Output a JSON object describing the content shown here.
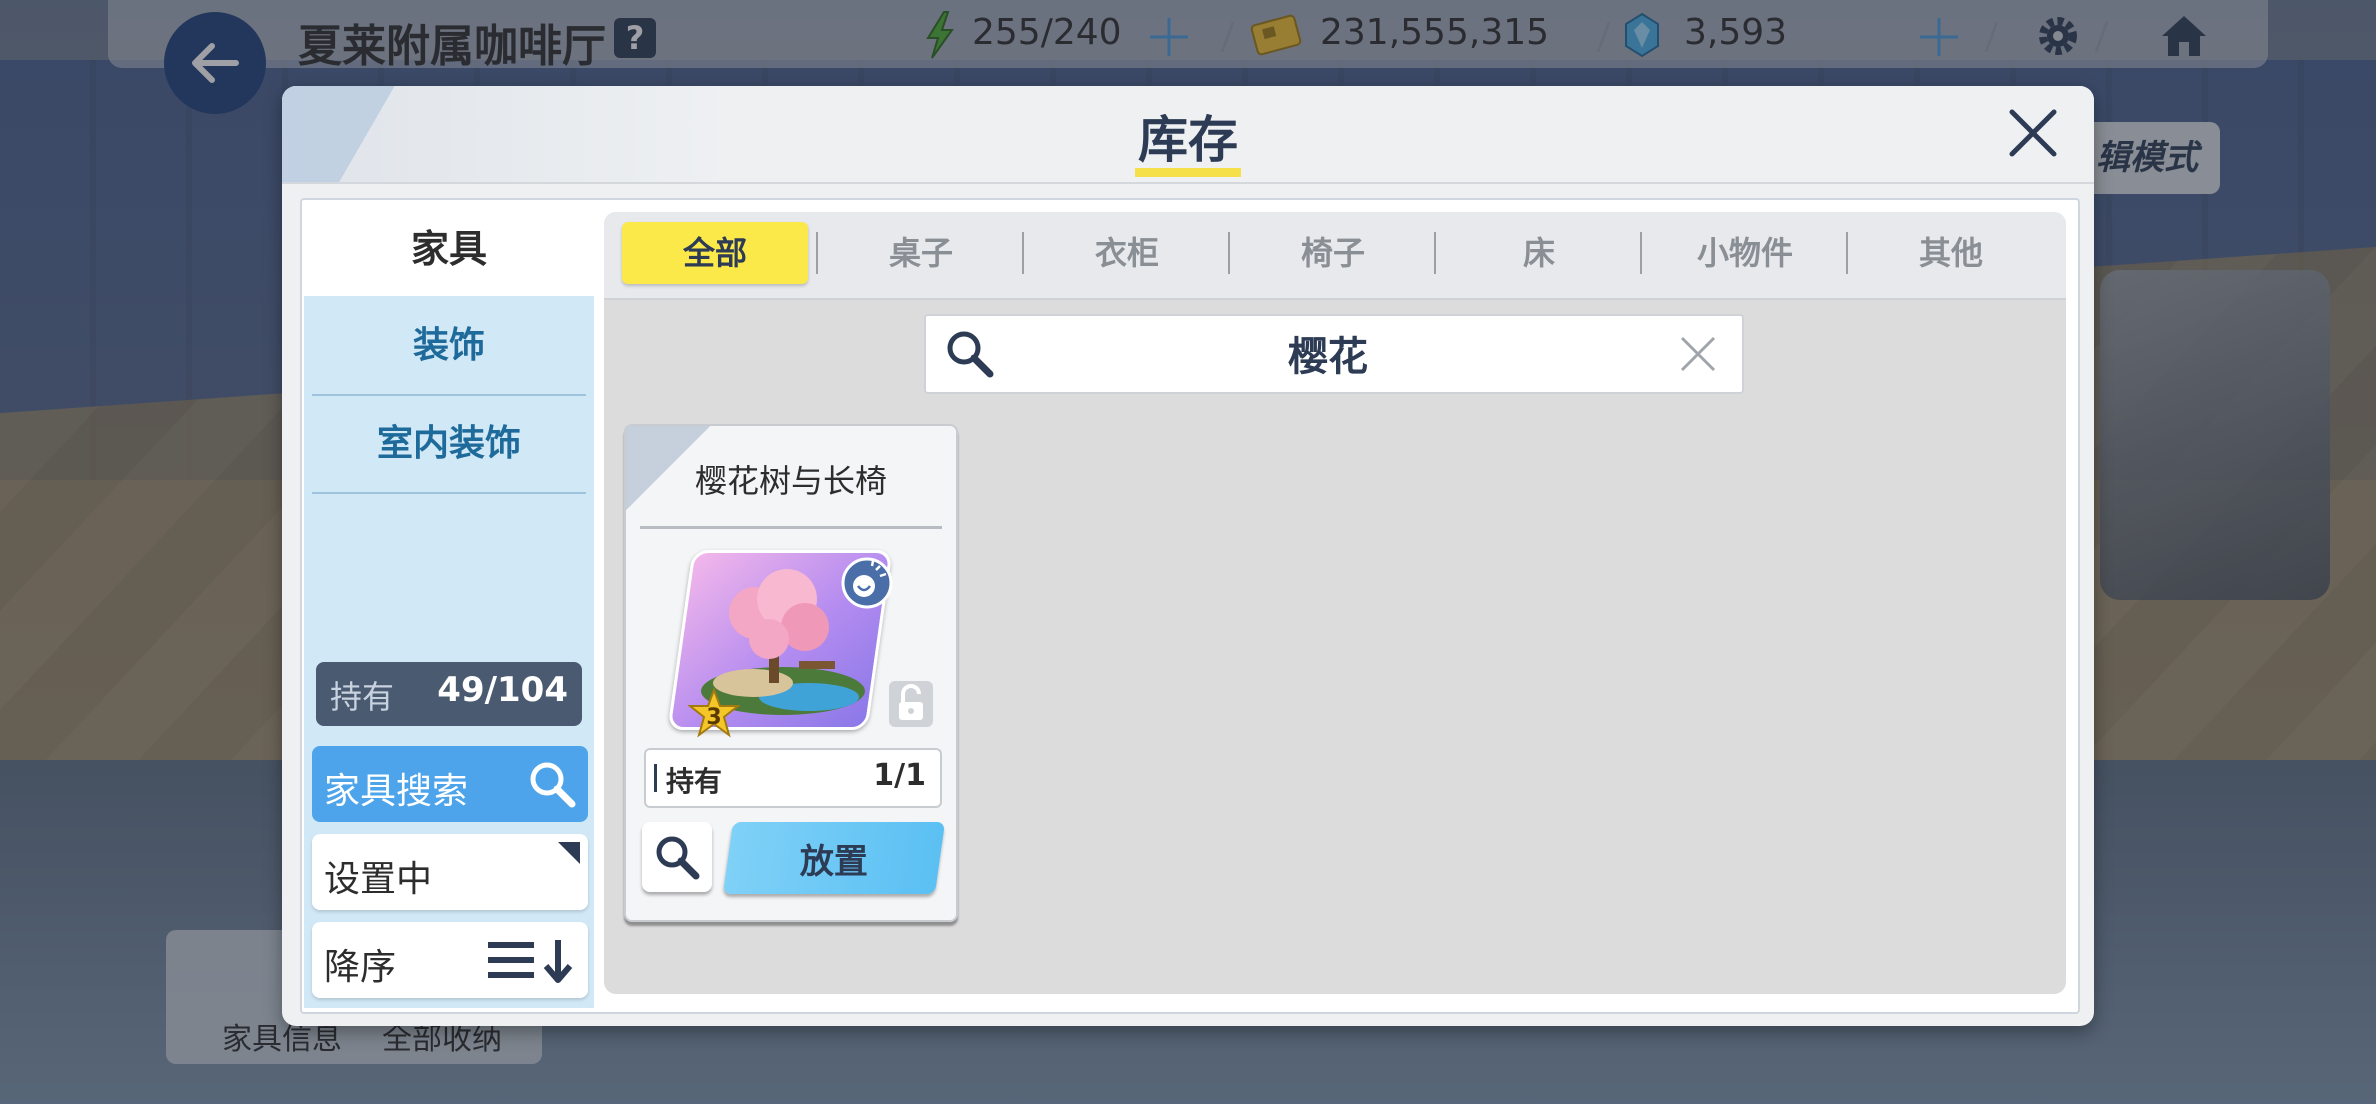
{
  "topbar": {
    "cafe_name": "夏莱附属咖啡厅",
    "help": "?",
    "ap": "255/240",
    "credits": "231,555,315",
    "gems": "3,593"
  },
  "background": {
    "edit_mode_label": "辑模式",
    "bottom_labels": [
      "家具信息",
      "全部收纳"
    ]
  },
  "modal": {
    "title": "库存",
    "sidebar": {
      "tabs": [
        "家具",
        "装饰",
        "室内装饰"
      ],
      "owned_label": "持有",
      "owned_value": "49/104",
      "search_label": "家具搜索",
      "setting_label": "设置中",
      "sort_label": "降序"
    },
    "categories": [
      "全部",
      "桌子",
      "衣柜",
      "椅子",
      "床",
      "小物件",
      "其他"
    ],
    "search_value": "樱花",
    "items": [
      {
        "name": "樱花树与长椅",
        "rarity": "3",
        "owned_label": "持有",
        "owned_value": "1/1",
        "place_label": "放置"
      }
    ]
  },
  "colors": {
    "accent_yellow": "#fbe94a",
    "accent_blue": "#4ea4ea",
    "navy": "#2d3b55"
  }
}
